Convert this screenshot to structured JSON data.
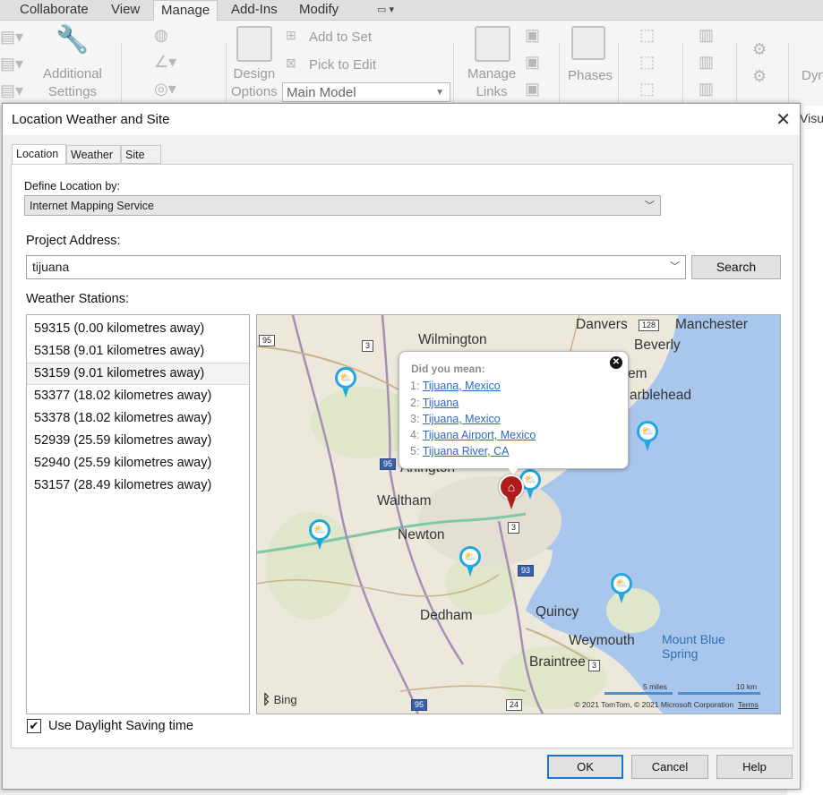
{
  "ribbon": {
    "tabs": [
      "Collaborate",
      "View",
      "Manage",
      "Add-Ins",
      "Modify"
    ],
    "active_tab": "Manage",
    "additional_settings": "Additional\nSettings",
    "design_options": "Design\nOptions",
    "add_to_set": "Add to Set",
    "pick_to_edit": "Pick to Edit",
    "main_model": "Main Model",
    "manage_links": "Manage\nLinks",
    "phases": "Phases",
    "dyn": "Dyn",
    "visua": "Visua"
  },
  "dialog": {
    "title": "Location Weather and Site",
    "tabs": [
      "Location",
      "Weather",
      "Site"
    ],
    "active_tab": "Location",
    "define_location_label": "Define Location by:",
    "define_location_value": "Internet Mapping Service",
    "project_address_label": "Project Address:",
    "project_address_value": "tijuana",
    "search_button": "Search",
    "weather_stations_label": "Weather Stations:",
    "stations": [
      "59315 (0.00 kilometres away)",
      "53158 (9.01 kilometres away)",
      "53159 (9.01 kilometres away)",
      "53377 (18.02 kilometres away)",
      "53378 (18.02 kilometres away)",
      "52939 (25.59 kilometres away)",
      "52940 (25.59 kilometres away)",
      "53157 (28.49 kilometres away)"
    ],
    "selected_station_index": 2,
    "daylight_saving_label": "Use Daylight Saving time",
    "daylight_saving_checked": true,
    "ok": "OK",
    "cancel": "Cancel",
    "help": "Help"
  },
  "map": {
    "labels": [
      "Danvers",
      "Manchester",
      "Wilmington",
      "Beverly",
      "em",
      "arblehead",
      "Arlington",
      "Waltham",
      "Newton",
      "Dedham",
      "Quincy",
      "Weymouth",
      "Braintree"
    ],
    "water_label": "Mount Blue\nSpring",
    "shields": [
      "95",
      "3",
      "128",
      "95",
      "3",
      "93",
      "3",
      "95",
      "24"
    ],
    "popup": {
      "heading": "Did you mean:",
      "items": [
        {
          "num": "1:",
          "text": "Tijuana, Mexico"
        },
        {
          "num": "2:",
          "text": "Tijuana"
        },
        {
          "num": "3:",
          "text": "Tijuana, Mexico"
        },
        {
          "num": "4:",
          "text": "Tijuana Airport, Mexico"
        },
        {
          "num": "5:",
          "text": "Tijuana River, CA"
        }
      ]
    },
    "bing": "Bing",
    "scale_miles": "5 miles",
    "scale_km": "10 km",
    "copyright": "© 2021 TomTom, © 2021 Microsoft Corporation",
    "terms": "Terms"
  }
}
